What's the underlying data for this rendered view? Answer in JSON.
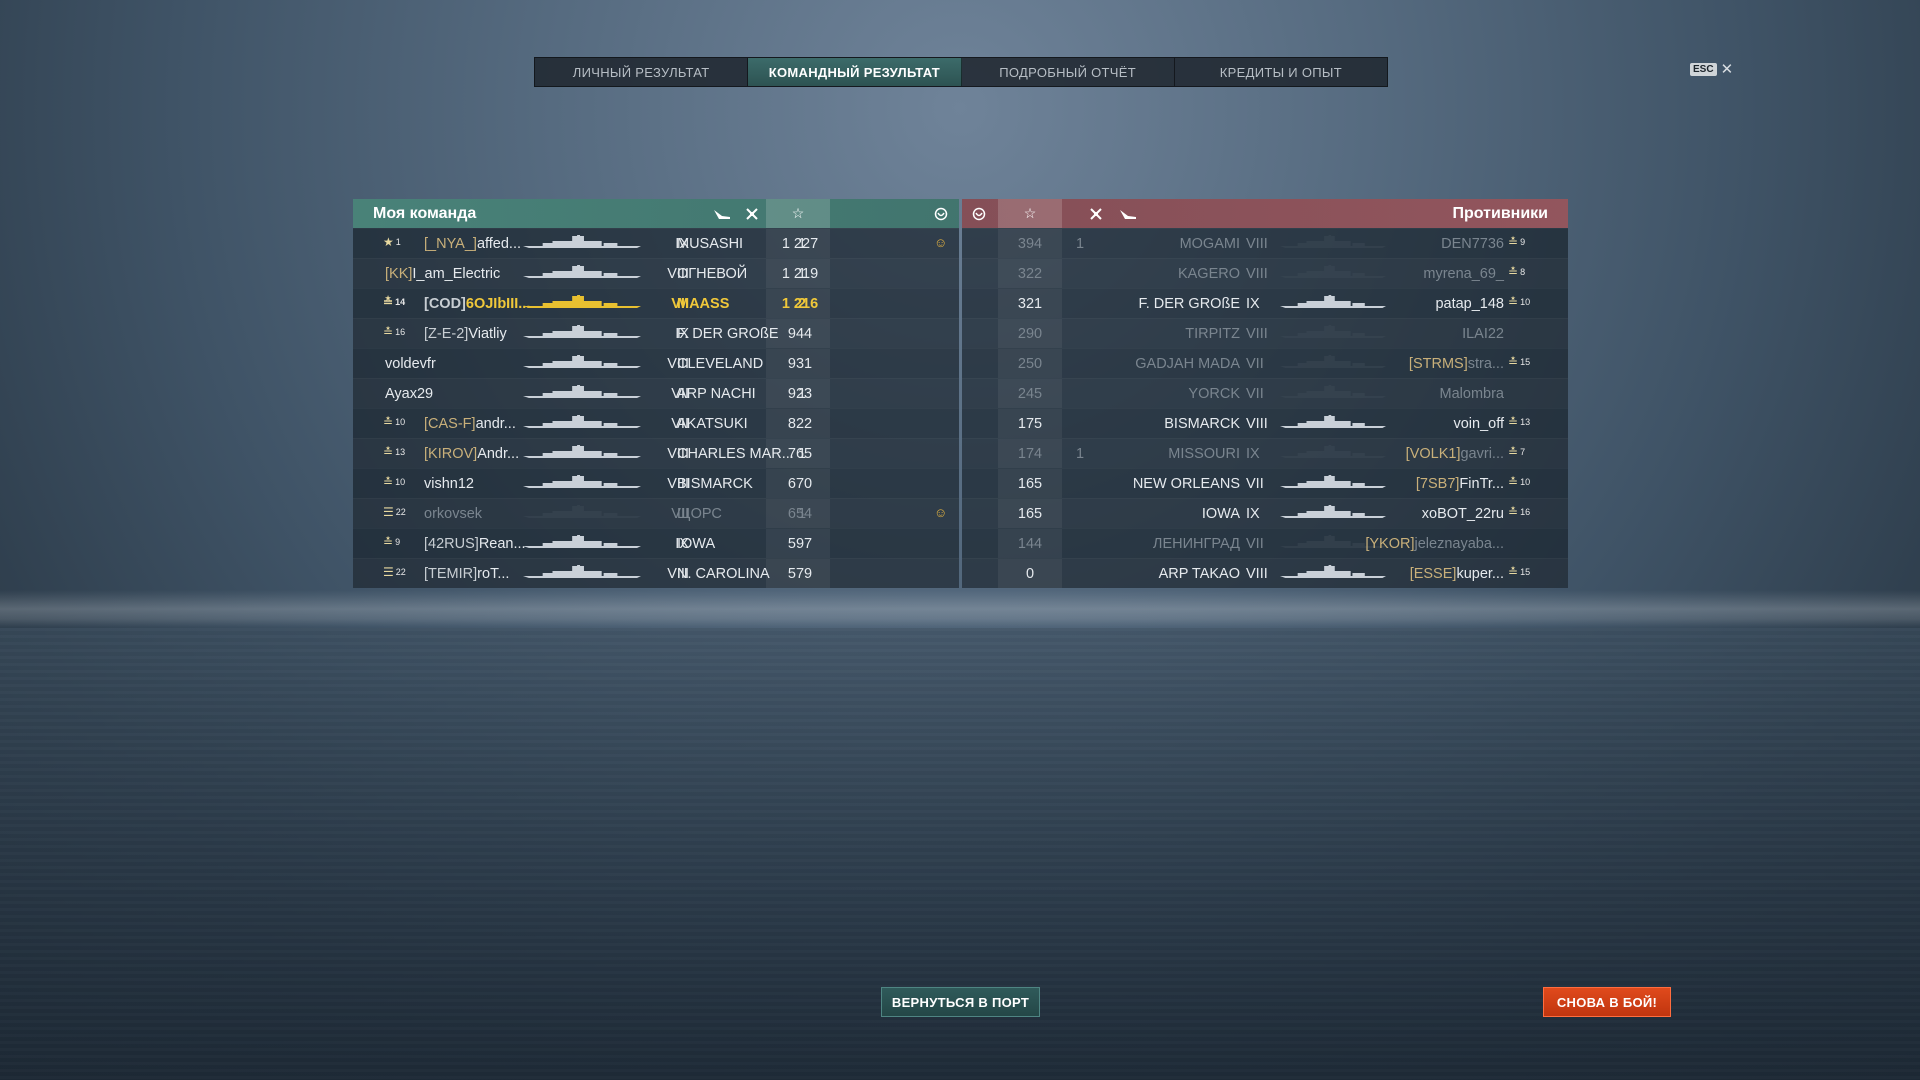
{
  "tabs": [
    {
      "label": "ЛИЧНЫЙ РЕЗУЛЬТАТ",
      "active": false
    },
    {
      "label": "КОМАНДНЫЙ РЕЗУЛЬТАТ",
      "active": true
    },
    {
      "label": "ПОДРОБНЫЙ ОТЧЁТ",
      "active": false
    },
    {
      "label": "КРЕДИТЫ И ОПЫТ",
      "active": false
    }
  ],
  "esc": {
    "key": "ESC",
    "close": "✕"
  },
  "my_team": {
    "title": "Моя команда",
    "players": [
      {
        "rank": "1",
        "rank_icon": "star-chevron",
        "clan": "[_NYA_]",
        "name": "affed...",
        "tier": "IX",
        "ship": "MUSASHI",
        "planes": "1",
        "xp": "1 227",
        "achievement": true,
        "me": false,
        "dead": false
      },
      {
        "rank": "",
        "rank_icon": "",
        "clan": "[KK]",
        "name": "I_am_Electric",
        "tier": "VIII",
        "ship": "ОГНЕВОЙ",
        "planes": "1",
        "xp": "1 219",
        "achievement": false,
        "me": false,
        "dead": false
      },
      {
        "rank": "14",
        "rank_icon": "chevron",
        "clan": "[COD]",
        "name": "6OJIbIII...",
        "tier": "VII",
        "ship": "MAASS",
        "planes": "2",
        "xp": "1 216",
        "achievement": false,
        "me": true,
        "dead": false
      },
      {
        "rank": "16",
        "rank_icon": "chevron",
        "clan": "[Z-E-2]",
        "name": "Viatliy",
        "tier": "IX",
        "ship": "F. DER GROßE",
        "planes": "",
        "xp": "944",
        "achievement": false,
        "me": false,
        "dead": false
      },
      {
        "rank": "",
        "rank_icon": "",
        "clan": "",
        "name": "voldevfr",
        "tier": "VIII",
        "ship": "CLEVELAND",
        "planes": "",
        "xp": "931",
        "achievement": false,
        "me": false,
        "dead": false
      },
      {
        "rank": "",
        "rank_icon": "",
        "clan": "",
        "name": "Ayax29",
        "tier": "VII",
        "ship": "ARP NACHI",
        "planes": "1",
        "xp": "923",
        "achievement": false,
        "me": false,
        "dead": false
      },
      {
        "rank": "10",
        "rank_icon": "chevron",
        "clan": "[CAS-F]",
        "name": "andr...",
        "tier": "VII",
        "ship": "AKATSUKI",
        "planes": "",
        "xp": "822",
        "achievement": false,
        "me": false,
        "dead": false
      },
      {
        "rank": "13",
        "rank_icon": "chevron",
        "clan": "[KIROV]",
        "name": "Andr...",
        "tier": "VIII",
        "ship": "CHARLES MAR...",
        "planes": "1",
        "xp": "765",
        "achievement": false,
        "me": false,
        "dead": false
      },
      {
        "rank": "10",
        "rank_icon": "chevron",
        "clan": "",
        "name": "vishn12",
        "tier": "VIII",
        "ship": "BISMARCK",
        "planes": "",
        "xp": "670",
        "achievement": false,
        "me": false,
        "dead": false
      },
      {
        "rank": "22",
        "rank_icon": "bars",
        "clan": "",
        "name": "orkovsek",
        "tier": "VII",
        "ship": "ЩОРС",
        "planes": "1",
        "xp": "654",
        "achievement": true,
        "me": false,
        "dead": true
      },
      {
        "rank": "9",
        "rank_icon": "chevron",
        "clan": "[42RUS]",
        "name": "Rean...",
        "tier": "IX",
        "ship": "IOWA",
        "planes": "",
        "xp": "597",
        "achievement": false,
        "me": false,
        "dead": false
      },
      {
        "rank": "22",
        "rank_icon": "bars",
        "clan": "[TEMIR]",
        "name": "roT...",
        "tier": "VIII",
        "ship": "N. CAROLINA",
        "planes": "",
        "xp": "579",
        "achievement": false,
        "me": false,
        "dead": false
      }
    ]
  },
  "enemy_team": {
    "title": "Противники",
    "players": [
      {
        "xp": "394",
        "planes": "1",
        "ship": "MOGAMI",
        "tier": "VIII",
        "clan": "",
        "name": "DEN7736",
        "rank": "9",
        "dead": true
      },
      {
        "xp": "322",
        "planes": "",
        "ship": "KAGERO",
        "tier": "VIII",
        "clan": "",
        "name": "myrena_69_",
        "rank": "8",
        "dead": true
      },
      {
        "xp": "321",
        "planes": "",
        "ship": "F. DER GROßE",
        "tier": "IX",
        "clan": "",
        "name": "patap_148",
        "rank": "10",
        "dead": false
      },
      {
        "xp": "290",
        "planes": "",
        "ship": "TIRPITZ",
        "tier": "VIII",
        "clan": "",
        "name": "ILAI22",
        "rank": "",
        "dead": true
      },
      {
        "xp": "250",
        "planes": "",
        "ship": "GADJAH MADA",
        "tier": "VII",
        "clan": "[STRMS]",
        "name": "stra...",
        "rank": "15",
        "dead": true
      },
      {
        "xp": "245",
        "planes": "",
        "ship": "YORCK",
        "tier": "VII",
        "clan": "",
        "name": "Malombra",
        "rank": "",
        "dead": true
      },
      {
        "xp": "175",
        "planes": "",
        "ship": "BISMARCK",
        "tier": "VIII",
        "clan": "",
        "name": "voin_off",
        "rank": "13",
        "dead": false
      },
      {
        "xp": "174",
        "planes": "1",
        "ship": "MISSOURI",
        "tier": "IX",
        "clan": "[VOLK1]",
        "name": "gavri...",
        "rank": "7",
        "dead": true
      },
      {
        "xp": "165",
        "planes": "",
        "ship": "NEW ORLEANS",
        "tier": "VII",
        "clan": "[7SB7]",
        "name": "FinTr...",
        "rank": "10",
        "dead": false
      },
      {
        "xp": "165",
        "planes": "",
        "ship": "IOWA",
        "tier": "IX",
        "clan": "",
        "name": "xoBOT_22ru",
        "rank": "16",
        "dead": false
      },
      {
        "xp": "144",
        "planes": "",
        "ship": "ЛЕНИНГРАД",
        "tier": "VII",
        "clan": "[YKOR]",
        "name": "jeleznayaba...",
        "rank": "",
        "dead": true
      },
      {
        "xp": "0",
        "planes": "",
        "ship": "ARP TAKAO",
        "tier": "VIII",
        "clan": "[ESSE]",
        "name": "kuper...",
        "rank": "15",
        "dead": false
      }
    ]
  },
  "buttons": {
    "port": "ВЕРНУТЬСЯ В ПОРТ",
    "battle": "СНОВА В БОЙ!"
  },
  "colors": {
    "ally": "#498479",
    "enemy": "#965560",
    "highlight": "#f0c83a",
    "battle_button": "#d9421a"
  }
}
